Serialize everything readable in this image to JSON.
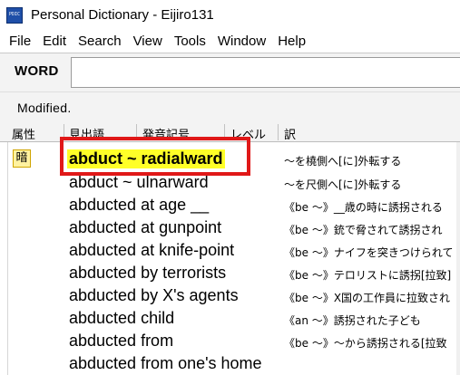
{
  "window": {
    "title": "Personal Dictionary - Eijiro131",
    "icon": "PDIC"
  },
  "menu": [
    "File",
    "Edit",
    "Search",
    "View",
    "Tools",
    "Window",
    "Help"
  ],
  "search": {
    "label": "WORD",
    "value": ""
  },
  "status": {
    "text": "Modified."
  },
  "columns": {
    "attribute": "属性",
    "headword": "見出語",
    "pronunciation": "発音記号",
    "level": "レベル",
    "translation": "訳"
  },
  "entries": [
    {
      "attr": "暗",
      "headword": "abduct ~ radialward",
      "translation": "～を橈側へ[に]外転する",
      "selected": true
    },
    {
      "attr": "",
      "headword": "abduct ~ ulnarward",
      "translation": "～を尺側へ[に]外転する",
      "selected": false
    },
    {
      "attr": "",
      "headword": "abducted at age __",
      "translation": "《be ～》__歳の時に誘拐される",
      "selected": false
    },
    {
      "attr": "",
      "headword": "abducted at gunpoint",
      "translation": "《be ～》銃で脅されて誘拐され",
      "selected": false
    },
    {
      "attr": "",
      "headword": "abducted at knife-point",
      "translation": "《be ～》ナイフを突きつけられて",
      "selected": false
    },
    {
      "attr": "",
      "headword": "abducted by terrorists",
      "translation": "《be ～》テロリストに誘拐[拉致]",
      "selected": false
    },
    {
      "attr": "",
      "headword": "abducted by X's agents",
      "translation": "《be ～》X国の工作員に拉致され",
      "selected": false
    },
    {
      "attr": "",
      "headword": "abducted child",
      "translation": "《an ～》誘拐された子ども",
      "selected": false
    },
    {
      "attr": "",
      "headword": "abducted from",
      "translation": "《be ～》～から誘拐される[拉致",
      "selected": false
    },
    {
      "attr": "",
      "headword": "abducted from one's home",
      "translation": "",
      "selected": false
    }
  ],
  "colors": {
    "selection_bg": "#ffff28",
    "annotation_box": "#e01818",
    "attr_badge_bg": "#fff2a0"
  }
}
